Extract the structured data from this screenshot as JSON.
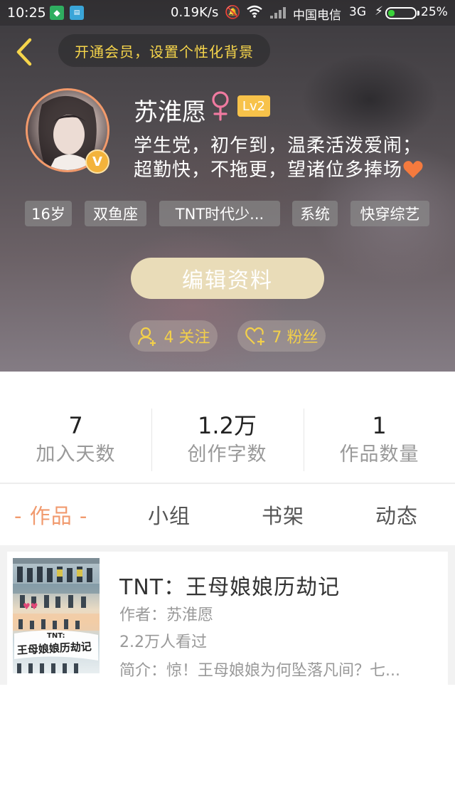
{
  "status_bar": {
    "time": "10:25",
    "net_speed": "0.19K/s",
    "carrier": "中国电信",
    "network": "3G",
    "battery": "25%",
    "battery_level": 0.25
  },
  "header": {
    "vip_banner": "开通会员，设置个性化背景",
    "username": "苏淮愿",
    "gender_symbol": "♀",
    "level": "Lv2",
    "verified_badge": "V",
    "bio": "学生党，初乍到，温柔活泼爱闹；超勤快，不拖更，望诸位多捧场",
    "tags": [
      "16岁",
      "双鱼座",
      "TNT时代少...",
      "系统",
      "快穿综艺"
    ],
    "edit_button": "编辑资料",
    "following": "4 关注",
    "followers": "7 粉丝"
  },
  "stats": [
    {
      "value": "7",
      "label": "加入天数"
    },
    {
      "value": "1.2万",
      "label": "创作字数"
    },
    {
      "value": "1",
      "label": "作品数量"
    }
  ],
  "tabs": [
    {
      "label": "作品",
      "active": true
    },
    {
      "label": "小组",
      "active": false
    },
    {
      "label": "书架",
      "active": false
    },
    {
      "label": "动态",
      "active": false
    }
  ],
  "works": [
    {
      "title": "TNT：王母娘娘历劫记",
      "author": "作者：苏淮愿",
      "views": "2.2万人看过",
      "intro": "简介：惊！王母娘娘为何坠落凡间？七...",
      "cover_text_top": "TNT:",
      "cover_text_main": "王母娘娘历劫记"
    }
  ],
  "colors": {
    "accent_orange": "#f19a6e",
    "vip_yellow": "#f6d54b",
    "edit_button_bg": "#e9dcb8",
    "level_badge": "#f7c24a"
  }
}
